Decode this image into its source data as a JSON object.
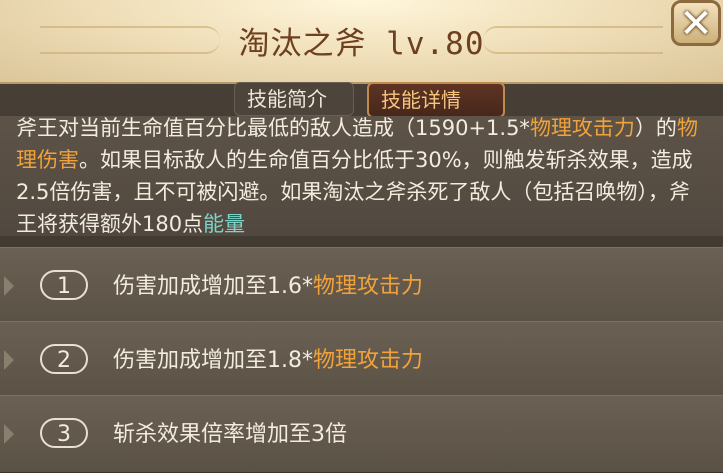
{
  "header": {
    "title": "淘汰之斧 lv.80",
    "close_label": "✕"
  },
  "tabs": [
    {
      "label": "技能简介",
      "active": false
    },
    {
      "label": "技能详情",
      "active": true
    }
  ],
  "description": {
    "p1": "斧王对当前生命值百分比最低的敌人造成（1590+1.5*",
    "p2": "物理攻击力",
    "p3": "）的",
    "p4": "物理伤害",
    "p5": "。如果目标敌人的生命值百分比低于30%，则触发斩杀效果，造成2.5倍伤害，且不可被闪避。如果淘汰之斧杀死了敌人（包括召唤物），斧王将获得额外180点",
    "p6": "能量"
  },
  "upgrades": [
    {
      "number": "1",
      "text": "伤害加成增加至1.6*",
      "highlight": "物理攻击力"
    },
    {
      "number": "2",
      "text": "伤害加成增加至1.8*",
      "highlight": "物理攻击力"
    },
    {
      "number": "3",
      "text": "斩杀效果倍率增加至3倍",
      "highlight": ""
    }
  ],
  "colors": {
    "highlight": "#f1a23a",
    "energy": "#7ed3c7",
    "title": "#6d4020"
  }
}
